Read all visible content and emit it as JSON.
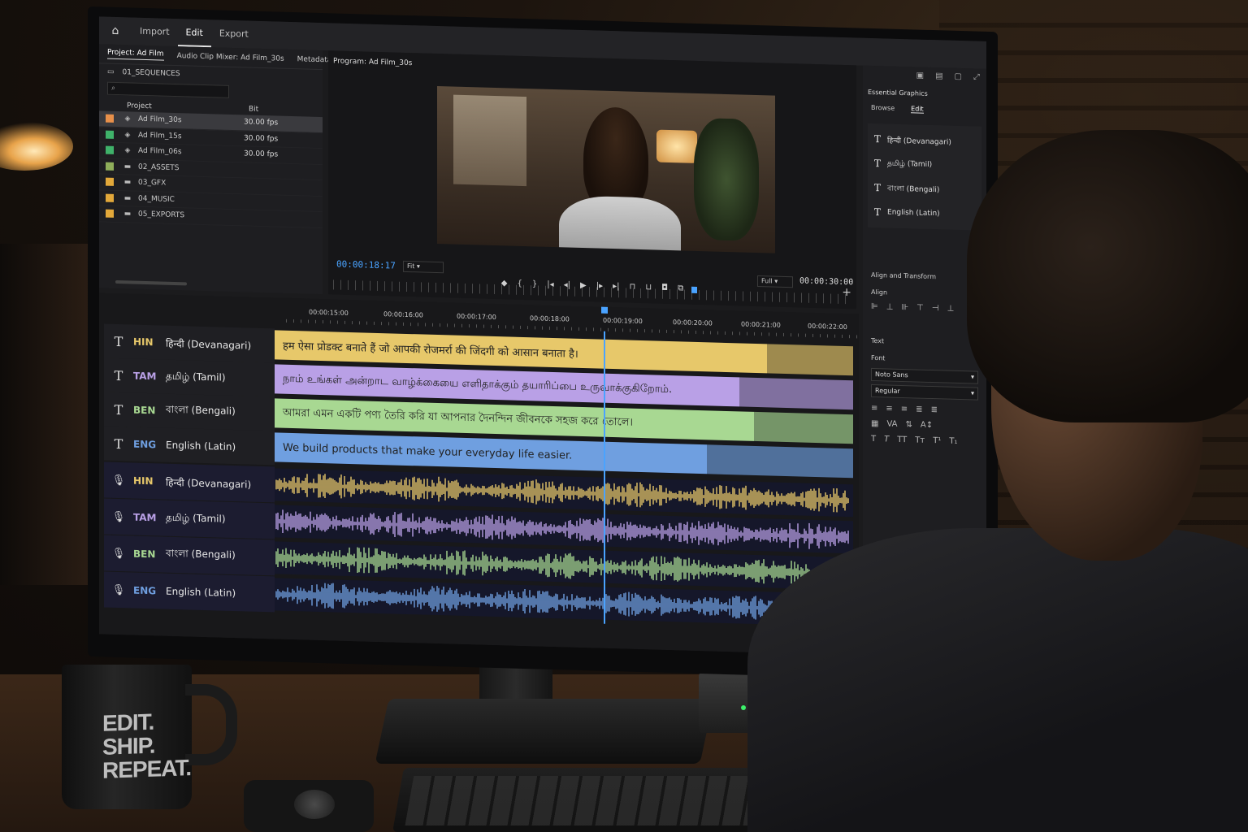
{
  "colors": {
    "hin": "#e7c86a",
    "tam": "#b9a0e6",
    "ben": "#a8d892",
    "eng": "#6f9fe0",
    "accent": "#4aa3ff"
  },
  "topbar": {
    "tabs": [
      "Import",
      "Edit",
      "Export"
    ],
    "active": "Edit"
  },
  "project": {
    "tab_project": "Project: Ad Film",
    "tab_mixer": "Audio Clip Mixer: Ad Film_30s",
    "tab_metadata": "Metadata",
    "path": "01_SEQUENCES",
    "col_name": "Project",
    "col_rate": "Bit",
    "rows": [
      {
        "name": "Ad Film_30s",
        "fps": "30.00 fps",
        "color": "#e8904a"
      },
      {
        "name": "Ad Film_15s",
        "fps": "30.00 fps",
        "color": "#3fb26a"
      },
      {
        "name": "Ad Film_06s",
        "fps": "30.00 fps",
        "color": "#3fb26a"
      },
      {
        "name": "02_ASSETS",
        "fps": "",
        "color": "#8fae5a"
      },
      {
        "name": "03_GFX",
        "fps": "",
        "color": "#e2a83a"
      },
      {
        "name": "04_MUSIC",
        "fps": "",
        "color": "#e2a83a"
      },
      {
        "name": "05_EXPORTS",
        "fps": "",
        "color": "#e2a83a"
      }
    ]
  },
  "program": {
    "title": "Program: Ad Film_30s",
    "timecode": "00:00:18:17",
    "fit": "Fit",
    "quality": "Full",
    "duration": "00:00:30:00"
  },
  "essential_graphics": {
    "title": "Essential Graphics",
    "tab_browse": "Browse",
    "tab_edit": "Edit",
    "layers": [
      "हिन्दी (Devanagari)",
      "தமிழ் (Tamil)",
      "বাংলা (Bengali)",
      "English (Latin)"
    ],
    "align_transform": "Align and Transform",
    "align": "Align",
    "text": "Text",
    "font_label": "Font",
    "font": "Noto Sans",
    "style": "Regular"
  },
  "timeline": {
    "ruler": [
      "00:00:15:00",
      "00:00:16:00",
      "00:00:17:00",
      "00:00:18:00",
      "00:00:19:00",
      "00:00:20:00",
      "00:00:21:00",
      "00:00:22:00"
    ],
    "text_tracks": [
      {
        "code": "HIN",
        "lang": "हिन्दी (Devanagari)",
        "text": "हम ऐसा प्रोडक्ट बनाते हैं जो आपकी रोजमर्रा की जिंदगी को आसान बनाता है।"
      },
      {
        "code": "TAM",
        "lang": "தமிழ் (Tamil)",
        "text": "நாம் உங்கள் அன்றாட வாழ்க்கையை எளிதாக்கும் தயாரிப்பை உருவாக்குகிறோம்."
      },
      {
        "code": "BEN",
        "lang": "বাংলা (Bengali)",
        "text": "আমরা এমন একটি পণ্য তৈরি করি যা আপনার দৈনন্দিন জীবনকে সহজ করে তোলে।"
      },
      {
        "code": "ENG",
        "lang": "English (Latin)",
        "text": "We build products that make your everyday life easier."
      }
    ],
    "audio_tracks": [
      {
        "code": "HIN",
        "lang": "हिन्दी (Devanagari)"
      },
      {
        "code": "TAM",
        "lang": "தமிழ் (Tamil)"
      },
      {
        "code": "BEN",
        "lang": "বাংলা (Bengali)"
      },
      {
        "code": "ENG",
        "lang": "English (Latin)"
      }
    ]
  },
  "mug": {
    "line1": "EDIT.",
    "line2": "SHIP.",
    "line3": "REPEAT."
  }
}
